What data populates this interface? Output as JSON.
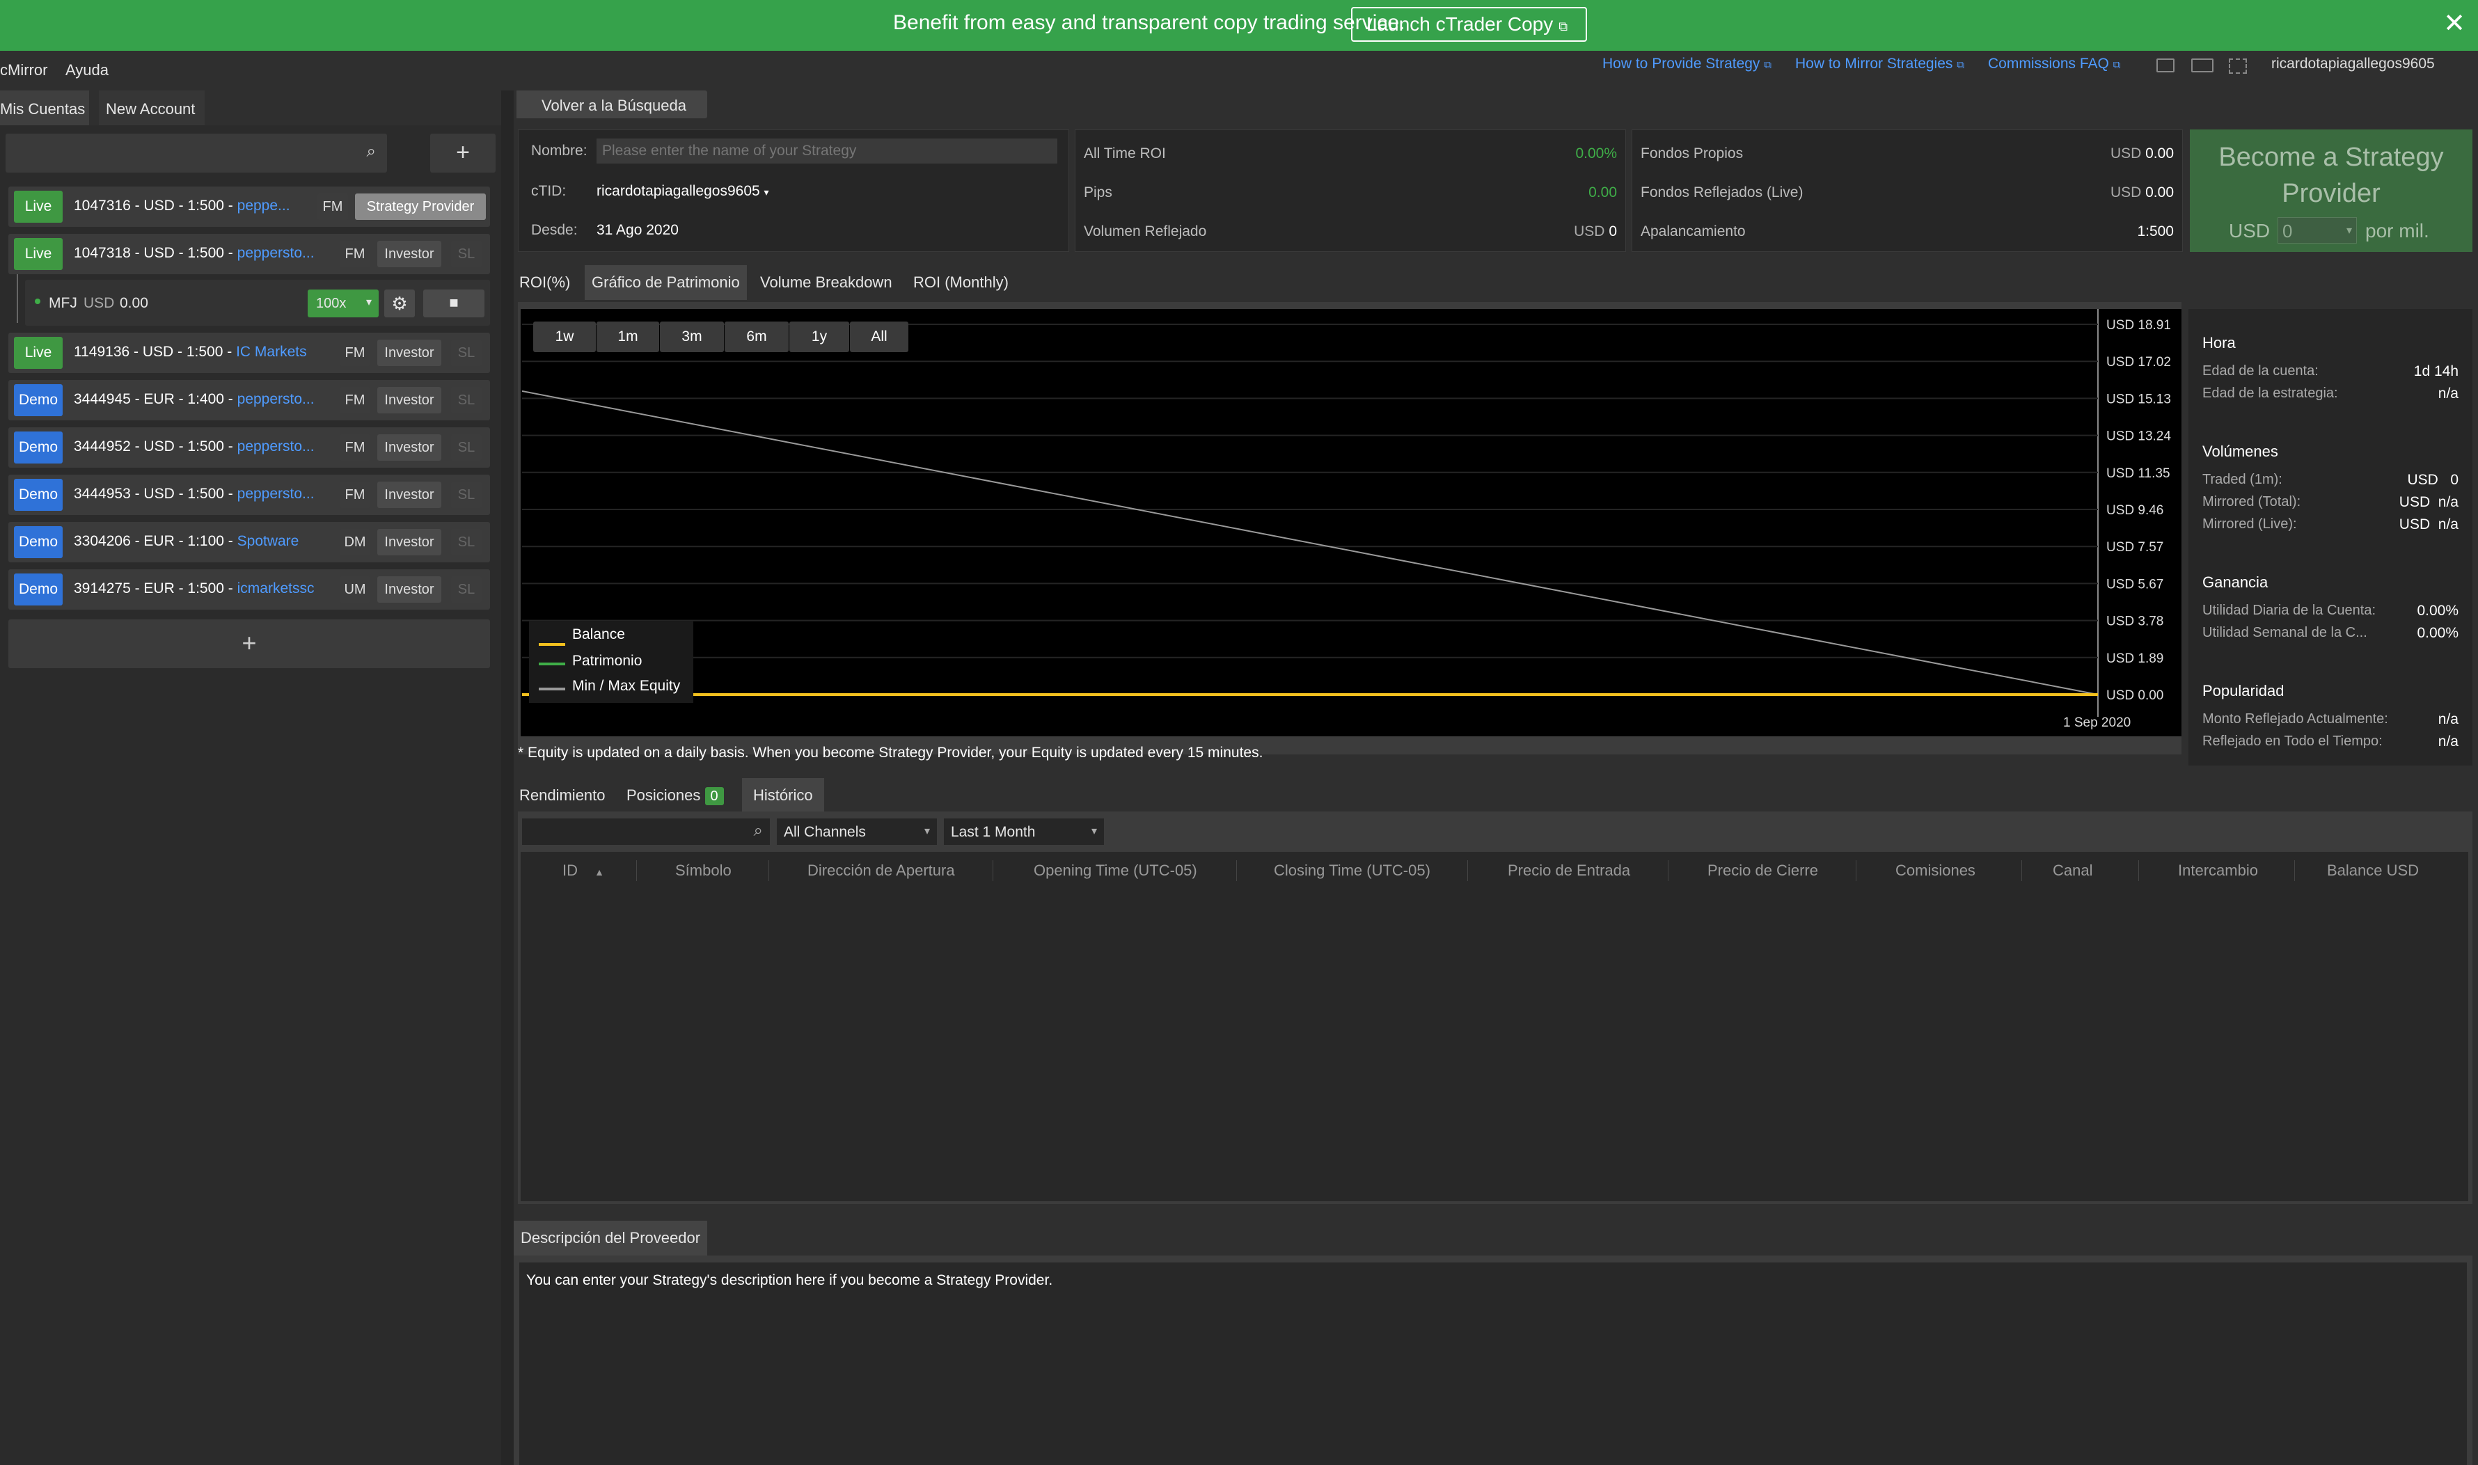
{
  "banner": {
    "text": "Benefit from easy and transparent copy trading service.",
    "launch_label": "Launch cTrader Copy"
  },
  "menu": {
    "app": "cMirror",
    "help": "Ayuda"
  },
  "top_links": {
    "provide": "How to Provide Strategy",
    "mirror": "How to Mirror Strategies",
    "faq": "Commissions FAQ",
    "user": "ricardotapiagallegos9605"
  },
  "left": {
    "tabs": [
      "Mis Cuentas",
      "New Account"
    ],
    "accounts": [
      {
        "type": "Live",
        "text": "1047316 - USD - 1:500 - ",
        "broker": "peppe...",
        "tag": "FM",
        "role": "Strategy Provider",
        "sl": ""
      },
      {
        "type": "Live",
        "text": "1047318 - USD - 1:500 - ",
        "broker": "pepperstо...",
        "tag": "FM",
        "role": "Investor",
        "sl": "SL"
      },
      {
        "type": "Live",
        "text": "1149136 - USD - 1:500 - ",
        "broker": "IC Markets",
        "tag": "FM",
        "role": "Investor",
        "sl": "SL"
      },
      {
        "type": "Demo",
        "text": "3444945 - EUR - 1:400 - ",
        "broker": "pepperstо...",
        "tag": "FM",
        "role": "Investor",
        "sl": "SL"
      },
      {
        "type": "Demo",
        "text": "3444952 - USD - 1:500 - ",
        "broker": "pepperstо...",
        "tag": "FM",
        "role": "Investor",
        "sl": "SL"
      },
      {
        "type": "Demo",
        "text": "3444953 - USD - 1:500 - ",
        "broker": "pepperstо...",
        "tag": "FM",
        "role": "Investor",
        "sl": "SL"
      },
      {
        "type": "Demo",
        "text": "3304206 - EUR - 1:100 - ",
        "broker": "Spotware",
        "tag": "DM",
        "role": "Investor",
        "sl": "SL"
      },
      {
        "type": "Demo",
        "text": "3914275 - EUR - 1:500 - ",
        "broker": "icmarketssc",
        "tag": "UM",
        "role": "Investor",
        "sl": "SL"
      }
    ],
    "sub": {
      "name": "MFJ",
      "currency": "USD",
      "amount": "0.00",
      "leverage": "100x"
    }
  },
  "back_label": "Volver a la Búsqueda",
  "info": {
    "name_label": "Nombre:",
    "name_placeholder": "Please enter the name of your Strategy",
    "ctid_label": "cTID:",
    "ctid_value": "ricardotapiagallegos9605",
    "since_label": "Desde:",
    "since_value": "31 Ago 2020"
  },
  "stats1": [
    {
      "label": "All Time ROI",
      "value": "0.00%"
    },
    {
      "label": "Pips",
      "value": "0.00"
    },
    {
      "label": "Volumen Reflejado",
      "cur": "USD",
      "value": "0"
    }
  ],
  "stats2": [
    {
      "label": "Fondos Propios",
      "cur": "USD",
      "value": "0.00"
    },
    {
      "label": "Fondos Reflejados (Live)",
      "cur": "USD",
      "value": "0.00"
    },
    {
      "label": "Apalancamiento",
      "value": "1:500"
    }
  ],
  "become": {
    "title": "Become a Strategy Provider",
    "cur": "USD",
    "amount": "0",
    "suffix": "por mil."
  },
  "chart_tabs": [
    "ROI(%)",
    "Gráfico de Patrimonio",
    "Volume Breakdown",
    "ROI (Monthly)"
  ],
  "ranges": [
    "1w",
    "1m",
    "3m",
    "6m",
    "1y",
    "All"
  ],
  "chart_data": {
    "type": "line",
    "y_ticks": [
      "USD 18.91",
      "USD 17.02",
      "USD 15.13",
      "USD 13.24",
      "USD 11.35",
      "USD 9.46",
      "USD 7.57",
      "USD 5.67",
      "USD 3.78",
      "USD 1.89",
      "USD 0.00"
    ],
    "x_ticks": [
      "1 Sep 2020"
    ],
    "series": [
      {
        "name": "Balance",
        "color": "#f2c01e",
        "values": [
          0,
          0
        ]
      },
      {
        "name": "Patrimonio",
        "color": "#3fae48",
        "values": [
          0,
          0
        ]
      },
      {
        "name": "Min / Max Equity",
        "color": "#9a9a9a",
        "values": [
          15.5,
          0
        ]
      }
    ],
    "ylim": [
      0,
      18.91
    ]
  },
  "chart_note": "* Equity is updated on a daily basis. When you become Strategy Provider, your Equity is updated every 15 minutes.",
  "side": {
    "hora": {
      "title": "Hora",
      "rows": [
        {
          "label": "Edad de la cuenta:",
          "value": "1d 14h"
        },
        {
          "label": "Edad de la estrategia:",
          "value": "n/a"
        }
      ]
    },
    "vol": {
      "title": "Volúmenes",
      "rows": [
        {
          "label": "Traded (1m):",
          "cur": "USD",
          "value": "0"
        },
        {
          "label": "Mirrored (Total):",
          "cur": "USD",
          "value": "n/a"
        },
        {
          "label": "Mirrored (Live):",
          "cur": "USD",
          "value": "n/a"
        }
      ]
    },
    "gan": {
      "title": "Ganancia",
      "rows": [
        {
          "label": "Utilidad Diaria de la Cuenta:",
          "value": "0.00%"
        },
        {
          "label": "Utilidad Semanal de la C...",
          "value": "0.00%"
        }
      ]
    },
    "pop": {
      "title": "Popularidad",
      "rows": [
        {
          "label": "Monto Reflejado Actualmente:",
          "value": "n/a"
        },
        {
          "label": "Reflejado en Todo el Tiempo:",
          "value": "n/a"
        }
      ]
    }
  },
  "bottom_tabs": {
    "perf": "Rendimiento",
    "pos": "Posiciones",
    "pos_count": "0",
    "hist": "Histórico"
  },
  "filters": {
    "channels": "All Channels",
    "period": "Last 1 Month"
  },
  "columns": [
    "ID",
    "Símbolo",
    "Dirección de Apertura",
    "Opening Time (UTC-05)",
    "Closing Time (UTC-05)",
    "Precio de Entrada",
    "Precio de Cierre",
    "Comisiones",
    "Canal",
    "Intercambio",
    "Balance USD"
  ],
  "desc": {
    "tab": "Descripción del Proveedor",
    "text": "You can enter your Strategy's description here if you become a Strategy Provider."
  }
}
